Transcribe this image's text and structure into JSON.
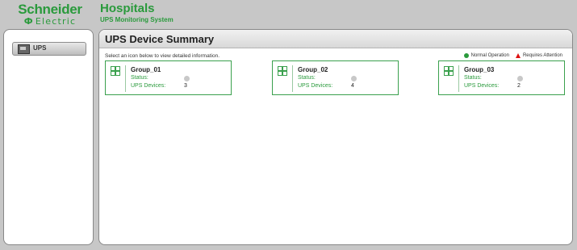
{
  "brand": {
    "name": "Schneider",
    "sub": "Electric",
    "sub_glyph": "Ф"
  },
  "app": {
    "title": "Hospitals",
    "subtitle": "UPS Monitoring System"
  },
  "sidebar": {
    "items": [
      {
        "label": "UPS",
        "icon": "ups-device-icon"
      }
    ]
  },
  "main": {
    "title": "UPS Device Summary",
    "instructions": "Select an icon below to view detailed information.",
    "legend": {
      "normal": {
        "label": "Normal Operation",
        "color": "#2a9a3c"
      },
      "attention": {
        "label": "Requires Attention",
        "color": "#d11111"
      }
    },
    "groups": [
      {
        "name": "Group_01",
        "status_label": "Status:",
        "status": "unknown",
        "devices_label": "UPS Devices:",
        "devices": "3"
      },
      {
        "name": "Group_02",
        "status_label": "Status:",
        "status": "unknown",
        "devices_label": "UPS Devices:",
        "devices": "4"
      },
      {
        "name": "Group_03",
        "status_label": "Status:",
        "status": "unknown",
        "devices_label": "UPS Devices:",
        "devices": "2"
      }
    ]
  },
  "colors": {
    "brand_green": "#2a9a3c",
    "status_unknown": "#c8c8c8"
  }
}
